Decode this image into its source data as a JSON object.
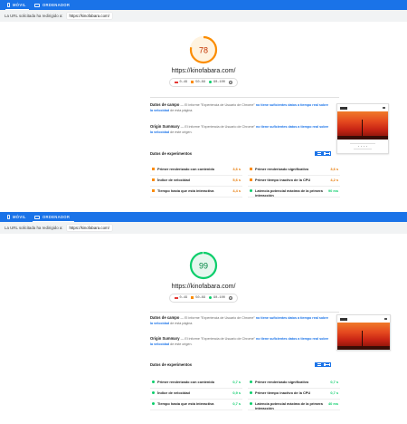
{
  "panels": [
    {
      "tabs": [
        {
          "label": "MÓVIL",
          "active": true
        },
        {
          "label": "ORDENADOR",
          "active": false
        }
      ],
      "url_notice": {
        "label": "La URL solicitada ha redirigido a:",
        "value": "https://kinofabara.com/"
      },
      "score": {
        "value": "78",
        "fraction": 0.78,
        "color": "#fb8c00",
        "bg": "#fff3e0",
        "text_color": "#c33300"
      },
      "site_url": "https://kinofabara.com/",
      "legend": {
        "red": "0–49",
        "orange": "50–89",
        "green": "90–100",
        "info_icon": "info-icon"
      },
      "field_data": {
        "title": "Datos de campo",
        "text_before": "— El informe \"Experiencia de Usuario de Chrome\"",
        "link": "no tiene suficientes datos a tiempo real sobre la velocidad",
        "text_after": "de esta página."
      },
      "origin_summary": {
        "title": "Origin Summary",
        "text_before": "— El informe \"Experiencia de Usuario de Chrome\"",
        "link": "no tiene suficientes datos a tiempo real sobre la velocidad",
        "text_after": "de este origen."
      },
      "lab": {
        "title": "Datos de experimentos",
        "metrics": [
          {
            "name": "Primer renderizado con contenido",
            "value": "3,6 s",
            "status": "orange"
          },
          {
            "name": "Primer renderizado significativo",
            "value": "3,6 s",
            "status": "orange"
          },
          {
            "name": "Índice de velocidad",
            "value": "5,6 s",
            "status": "orange"
          },
          {
            "name": "Primer tiempo inactivo de la CPU",
            "value": "4,2 s",
            "status": "orange"
          },
          {
            "name": "Tiempo hasta que está interactiva",
            "value": "4,4 s",
            "status": "orange"
          },
          {
            "name": "Latencia potencial máxima de la primera interacción",
            "value": "90 ms",
            "status": "green"
          }
        ]
      }
    },
    {
      "tabs": [
        {
          "label": "MÓVIL",
          "active": false
        },
        {
          "label": "ORDENADOR",
          "active": true
        }
      ],
      "url_notice": {
        "label": "La URL solicitada ha redirigido a:",
        "value": "https://kinofabara.com/"
      },
      "score": {
        "value": "99",
        "fraction": 0.99,
        "color": "#0cce6b",
        "bg": "#e6f7ee",
        "text_color": "#018642"
      },
      "site_url": "https://kinofabara.com/",
      "legend": {
        "red": "0–49",
        "orange": "50–89",
        "green": "90–100",
        "info_icon": "info-icon"
      },
      "field_data": {
        "title": "Datos de campo",
        "text_before": "— El informe \"Experiencia de Usuario de Chrome\"",
        "link": "no tiene suficientes datos a tiempo real sobre la velocidad",
        "text_after": "de esta página."
      },
      "origin_summary": {
        "title": "Origin Summary",
        "text_before": "— El informe \"Experiencia de Usuario de Chrome\"",
        "link": "no tiene suficientes datos a tiempo real sobre la velocidad",
        "text_after": "de este origen."
      },
      "lab": {
        "title": "Datos de experimentos",
        "metrics": [
          {
            "name": "Primer renderizado con contenido",
            "value": "0,7 s",
            "status": "green"
          },
          {
            "name": "Primer renderizado significativo",
            "value": "0,7 s",
            "status": "green"
          },
          {
            "name": "Índice de velocidad",
            "value": "0,9 s",
            "status": "green"
          },
          {
            "name": "Primer tiempo inactivo de la CPU",
            "value": "0,7 s",
            "status": "green"
          },
          {
            "name": "Tiempo hasta que está interactiva",
            "value": "0,7 s",
            "status": "green"
          },
          {
            "name": "Latencia potencial máxima de la primera interacción",
            "value": "40 ms",
            "status": "green"
          }
        ]
      }
    }
  ]
}
